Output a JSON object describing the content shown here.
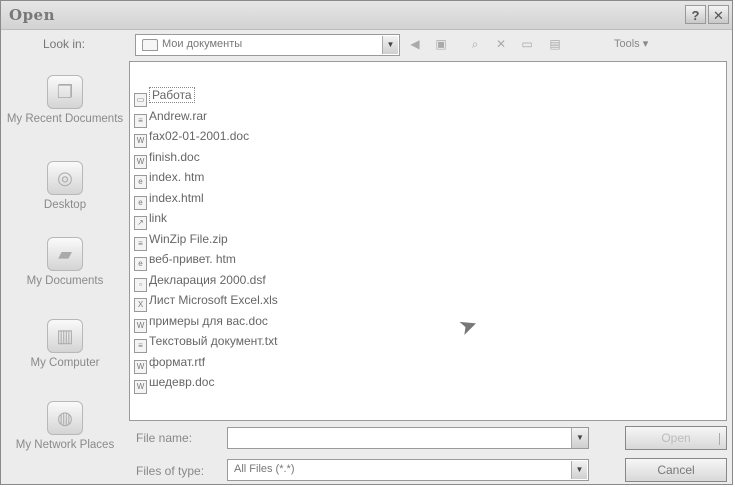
{
  "dialog": {
    "title": "Open",
    "help_glyph": "?",
    "close_glyph": "✕"
  },
  "lookin": {
    "label": "Look in:",
    "value": "Мои документы"
  },
  "toolbar": {
    "tools_label": "Tools ▾"
  },
  "places": [
    {
      "label": "My Recent Documents",
      "icon": "recent-documents-icon"
    },
    {
      "label": "Desktop",
      "icon": "desktop-icon"
    },
    {
      "label": "My Documents",
      "icon": "my-documents-icon"
    },
    {
      "label": "My Computer",
      "icon": "my-computer-icon"
    },
    {
      "label": "My Network Places",
      "icon": "network-places-icon"
    }
  ],
  "files": [
    {
      "name": "Работа",
      "icon": "folder-icon"
    },
    {
      "name": "Andrew.rar",
      "icon": "archive-icon"
    },
    {
      "name": "fax02-01-2001.doc",
      "icon": "word-doc-icon"
    },
    {
      "name": "finish.doc",
      "icon": "word-doc-icon"
    },
    {
      "name": "index. htm",
      "icon": "html-icon"
    },
    {
      "name": "index.html",
      "icon": "html-icon"
    },
    {
      "name": "link",
      "icon": "link-icon"
    },
    {
      "name": "WinZip File.zip",
      "icon": "archive-icon"
    },
    {
      "name": "веб-привет. htm",
      "icon": "html-icon"
    },
    {
      "name": "Декларация 2000.dsf",
      "icon": "generic-file-icon"
    },
    {
      "name": "Лист Microsoft Excel.xls",
      "icon": "excel-icon"
    },
    {
      "name": "примеры для вас.doc",
      "icon": "word-doc-icon"
    },
    {
      "name": "Текстовый документ.txt",
      "icon": "text-file-icon"
    },
    {
      "name": "формат.rtf",
      "icon": "rtf-icon"
    },
    {
      "name": "шедевр.doc",
      "icon": "word-doc-icon"
    }
  ],
  "filename": {
    "label": "File name:",
    "value": ""
  },
  "filetype": {
    "label": "Files of type:",
    "value": "All Files (*.*)"
  },
  "buttons": {
    "open_label": "Open",
    "cancel_label": "Cancel"
  }
}
